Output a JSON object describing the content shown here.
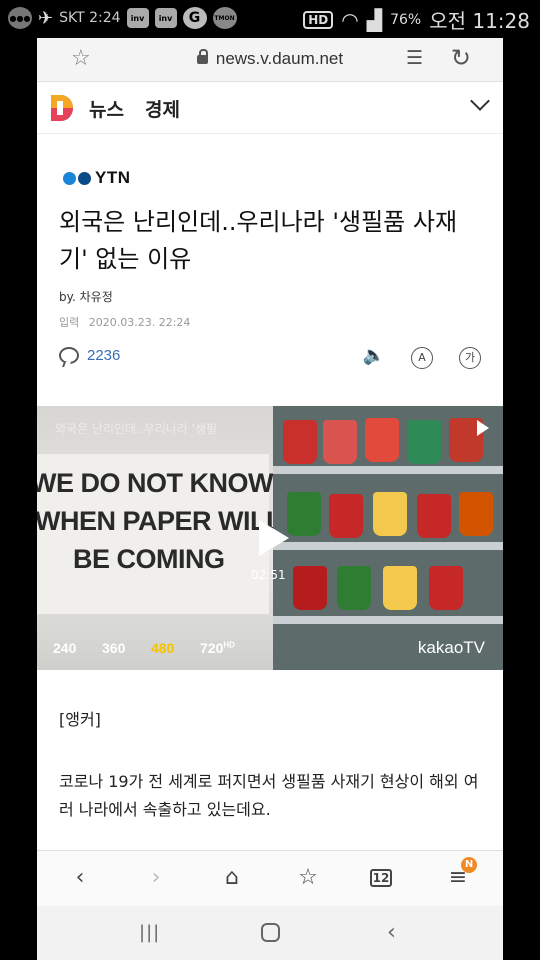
{
  "status_bar": {
    "carrier": "SKT 2:24",
    "icons": [
      "chat-icon",
      "nav-icon",
      "inv-icon",
      "inv-icon",
      "g-icon",
      "tmon-icon"
    ],
    "hd": "HD",
    "battery": "76%",
    "time": "오전 11:28"
  },
  "browser": {
    "url": "news.v.daum.net",
    "tabs_count": "12",
    "badge": "N"
  },
  "site": {
    "section_news": "뉴스",
    "section_category": "경제"
  },
  "article": {
    "source": "YTN",
    "headline": "외국은 난리인데..우리나라 '생필품 사재기' 없는 이유",
    "byline": "by. 차유정",
    "date_label": "입력",
    "date": "2020.03.23. 22:24",
    "comment_count": "2236",
    "font_tool_label": "A",
    "translate_tool_label": "가",
    "video": {
      "overlay_title": "외국은 난리인데..우리나라 '생필",
      "sign_lines": [
        "WE DO NOT KNOW",
        "WHEN PAPER WILL",
        "BE COMING"
      ],
      "time": "02:51",
      "qualities": [
        "240",
        "360",
        "480",
        "720"
      ],
      "quality_hd_suffix": "HD",
      "selected_quality": "480",
      "brand": "kakaoTV"
    },
    "paragraphs": [
      "[앵커]",
      "코로나 19가 전 세계로 퍼지면서 생필품 사재기 현상이 해외 여러 나라에서 속출하고 있는데요."
    ]
  },
  "colors": {
    "accent_blue": "#3a6cb5",
    "ytn_blue": "#1a86d8",
    "quality_selected": "#f5c400",
    "badge": "#f08a24"
  }
}
